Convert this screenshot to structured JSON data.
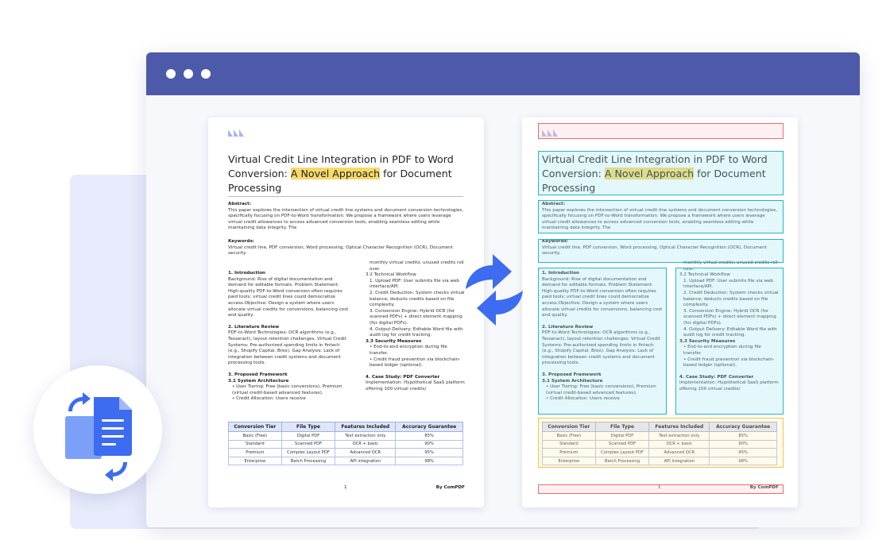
{
  "window": {
    "controls": [
      "close",
      "minimize",
      "maximize"
    ]
  },
  "document": {
    "title_before": "Virtual Credit Line Integration in PDF to Word Conversion: ",
    "title_highlight": "A Novel Approach",
    "title_after": " for Document Processing",
    "abstract_heading": "Abstract:",
    "abstract_text": "This paper explores the intersection of virtual credit line systems and document conversion technologies, specifically focusing on PDF-to-Word transformation. We propose a framework where users leverage virtual credit allowances to access advanced conversion tools, enabling seamless editing while maintaining data integrity. The",
    "keywords_heading": "Keywords:",
    "keywords_text": "Virtual credit line, PDF conversion, Word processing, Optical Character Recognition (OCR), Document security.",
    "left_column": {
      "intro_heading": "1. Introduction",
      "intro_text": "Background: Rise of digital documentation and demand for editable formats. Problem Statement: High-quality PDF-to-Word conversion often requires paid tools; virtual credit lines could democratize access.Objective: Design a system where users allocate virtual credits for conversions, balancing cost and quality.",
      "lit_heading": "2. Literature Review",
      "lit_text": "PDF-to-Word Technologies: OCR algorithms (e.g., Tesseract), layout retention challenges. Virtual Credit Systems: Pre-authorized spending limits in fintech (e.g., Shopify Capital, Brex). Gap Analysis: Lack of integration between credit systems and document processing tools.",
      "framework_heading": "3. Proposed Framework",
      "architecture_heading": "3.1 System Architecture",
      "bullet_1": "• User Tiering: Free (basic conversions), Premium (virtual credit-based advanced features).",
      "bullet_2": "• Credit Allocation: Users receive"
    },
    "right_column": {
      "cont_text": "monthly virtual credits; unused credits roll over.",
      "workflow_heading": "3.2 Technical Workflow",
      "step_1": "1. Upload PDF: User submits file via web interface/API.",
      "step_2": "2. Credit Deduction: System checks virtual balance; deducts credits based on file complexity.",
      "step_3": "3. Conversion Engine: Hybrid OCR (for scanned PDFs) + direct element mapping (for digital PDFs).",
      "step_4": "4. Output Delivery: Editable Word file with audit log for credit tracking.",
      "security_heading": "3.3 Security Measures",
      "sec_1": "• End-to-end encryption during file transfer.",
      "sec_2": "• Credit fraud prevention via blockchain-based ledger (optional).",
      "case_heading": "4. Case Study: PDF Converter",
      "case_text": "Implementation: Hypothetical SaaS platform offering 100 virtual credits/"
    },
    "table": {
      "headers": [
        "Conversion Tier",
        "File Type",
        "Features Included",
        "Accuracy Guarantee"
      ],
      "rows": [
        [
          "Basic (Free)",
          "Digital PDF",
          "Text extraction only",
          "85%"
        ],
        [
          "Standard",
          "Scanned PDF",
          "OCR + basic",
          "90%"
        ],
        [
          "Premium",
          "Complex Layout PDF",
          "Advanced OCR",
          "95%"
        ],
        [
          "Enterprise",
          "Batch Processing",
          "API integration",
          "98%"
        ]
      ]
    },
    "page_number": "1",
    "brand": "By ComPDF"
  },
  "colors": {
    "brand_bar": "#4d5aa9",
    "accent_blue": "#3d6cf0",
    "highlight": "#f7d96a",
    "overlay_red": "#ef6b6b",
    "overlay_cyan": "#27b5c8",
    "overlay_yellow": "#f0c743"
  },
  "icons": [
    "sync-arrows-icon",
    "document-convert-icon",
    "comppdf-logo-icon"
  ]
}
